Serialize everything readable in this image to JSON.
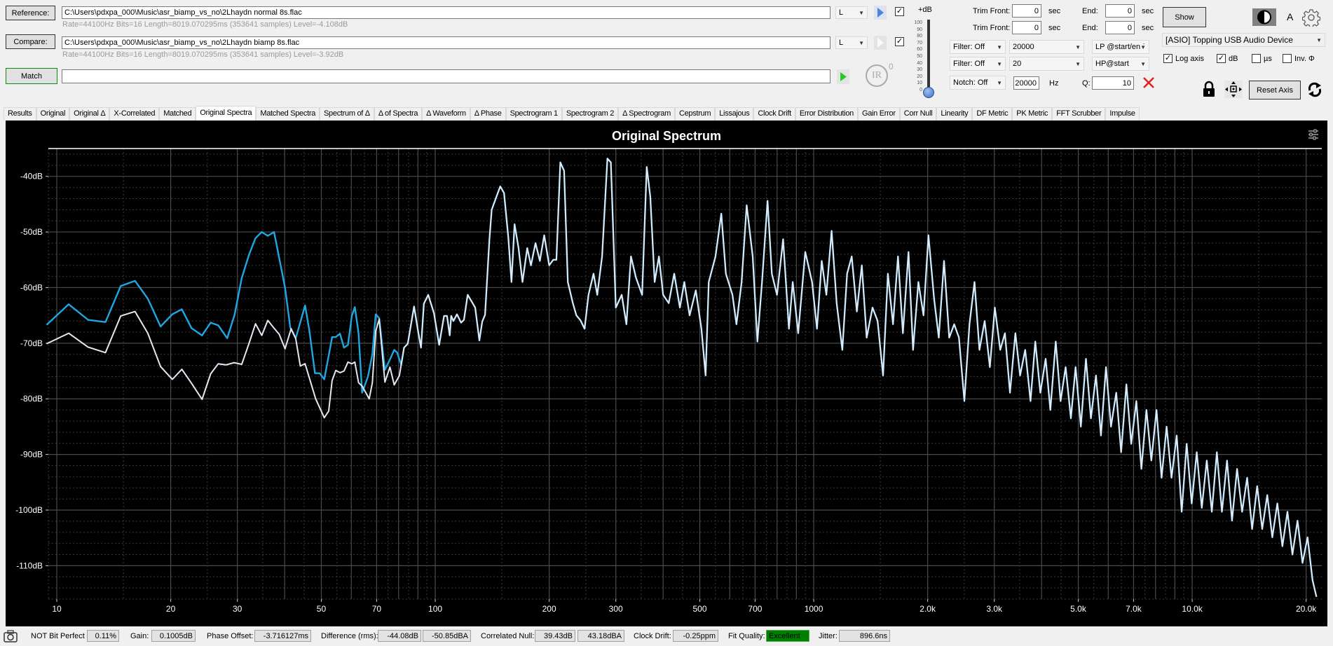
{
  "reference": {
    "button_label": "Reference:",
    "path": "C:\\Users\\pdxpa_000\\Music\\asr_biamp_vs_no\\2Lhaydn normal 8s.flac",
    "info": "Rate=44100Hz Bits=16 Length=8019.070295ms (353641 samples) Level=-4.108dB",
    "channel": "L",
    "checked": true
  },
  "compare": {
    "button_label": "Compare:",
    "path": "C:\\Users\\pdxpa_000\\Music\\asr_biamp_vs_no\\2Lhaydn biamp 8s.flac",
    "info": "Rate=44100Hz Bits=16 Length=8019.070295ms (353641 samples) Level=-3.92dB",
    "channel": "L",
    "checked": true
  },
  "match": {
    "button_label": "Match",
    "value": ""
  },
  "ir": {
    "label": "IR",
    "count": "0"
  },
  "gain_slider": {
    "label": "+dB",
    "ticks": [
      "100",
      "90",
      "80",
      "70",
      "60",
      "50",
      "40",
      "30",
      "20",
      "10",
      "0"
    ],
    "value": 0
  },
  "trim": [
    {
      "front_label": "Trim Front:",
      "front_value": "0",
      "front_unit": "sec",
      "end_label": "End:",
      "end_value": "0",
      "end_unit": "sec"
    },
    {
      "front_label": "Trim Front:",
      "front_value": "0",
      "front_unit": "sec",
      "end_label": "End:",
      "end_value": "0",
      "end_unit": "sec"
    }
  ],
  "filters": [
    {
      "mode": "Filter: Off",
      "freq": "20000",
      "type": "LP @start/end"
    },
    {
      "mode": "Filter: Off",
      "freq": "20",
      "type": "HP@start"
    }
  ],
  "notch": {
    "mode": "Notch: Off",
    "freq": "20000",
    "unit": "Hz",
    "q_label": "Q:",
    "q_value": "10"
  },
  "right_panel": {
    "show_label": "Show",
    "font_label": "A",
    "device": "[ASIO] Topping USB Audio Device",
    "options": [
      {
        "label": "Log axis",
        "checked": true
      },
      {
        "label": "dB",
        "checked": true
      },
      {
        "label": "µs",
        "checked": false
      },
      {
        "label": "Inv. Φ",
        "checked": false
      }
    ],
    "reset_axis_label": "Reset Axis"
  },
  "tabs": [
    "Results",
    "Original",
    "Original Δ",
    "X-Correlated",
    "Matched",
    "Original Spectra",
    "Matched Spectra",
    "Spectrum of Δ",
    "Δ of Spectra",
    "Δ Waveform",
    "Δ Phase",
    "Spectrogram 1",
    "Spectrogram 2",
    "Δ Spectrogram",
    "Cepstrum",
    "Lissajous",
    "Clock Drift",
    "Error Distribution",
    "Gain Error",
    "Corr Null",
    "Linearity",
    "DF Metric",
    "PK Metric",
    "FFT Scrubber",
    "Impulse"
  ],
  "active_tab": "Original Spectra",
  "chart_data": {
    "type": "line",
    "title": "Original Spectrum",
    "xscale": "log",
    "xlim": [
      9.5,
      22000
    ],
    "ylim": [
      -116,
      -35
    ],
    "grid": true,
    "background": "#000000",
    "xticks": [
      {
        "v": 10,
        "t": "10"
      },
      {
        "v": 20,
        "t": "20"
      },
      {
        "v": 30,
        "t": "30"
      },
      {
        "v": 50,
        "t": "50"
      },
      {
        "v": 70,
        "t": "70"
      },
      {
        "v": 100,
        "t": "100"
      },
      {
        "v": 200,
        "t": "200"
      },
      {
        "v": 300,
        "t": "300"
      },
      {
        "v": 500,
        "t": "500"
      },
      {
        "v": 700,
        "t": "700"
      },
      {
        "v": 1000,
        "t": "1000"
      },
      {
        "v": 2000,
        "t": "2.0k"
      },
      {
        "v": 3000,
        "t": "3.0k"
      },
      {
        "v": 5000,
        "t": "5.0k"
      },
      {
        "v": 7000,
        "t": "7.0k"
      },
      {
        "v": 10000,
        "t": "10.0k"
      },
      {
        "v": 20000,
        "t": "20.0k"
      }
    ],
    "yticks": [
      {
        "v": -40,
        "t": "-40dB"
      },
      {
        "v": -50,
        "t": "-50dB"
      },
      {
        "v": -60,
        "t": "-60dB"
      },
      {
        "v": -70,
        "t": "-70dB"
      },
      {
        "v": -80,
        "t": "-80dB"
      },
      {
        "v": -90,
        "t": "-90dB"
      },
      {
        "v": -100,
        "t": "-100dB"
      },
      {
        "v": -110,
        "t": "-110dB"
      }
    ],
    "series": [
      {
        "color": "#1ea7e1",
        "points": [
          [
            9.4,
            -66.7
          ],
          [
            10.75,
            -63.0
          ],
          [
            12.1,
            -65.8
          ],
          [
            13.45,
            -66.2
          ],
          [
            14.76,
            -59.7
          ],
          [
            16.1,
            -58.8
          ],
          [
            17.4,
            -62.0
          ],
          [
            18.8,
            -67.0
          ],
          [
            20.2,
            -64.8
          ],
          [
            21.4,
            -63.9
          ],
          [
            22.7,
            -67.3
          ],
          [
            24.2,
            -68.6
          ],
          [
            25.5,
            -66.3
          ],
          [
            26.7,
            -66.8
          ],
          [
            28.2,
            -69.1
          ],
          [
            29.5,
            -64.9
          ],
          [
            30.8,
            -58.3
          ],
          [
            32.2,
            -54.1
          ],
          [
            33.5,
            -51.1
          ],
          [
            34.8,
            -50.0
          ],
          [
            36.1,
            -50.7
          ],
          [
            37.5,
            -50.0
          ],
          [
            38.7,
            -54.7
          ],
          [
            40.1,
            -60.0
          ],
          [
            41.4,
            -67.2
          ],
          [
            42.8,
            -69.1
          ],
          [
            45.3,
            -63.2
          ],
          [
            46.5,
            -67.8
          ],
          [
            48.1,
            -75.4
          ],
          [
            49.5,
            -75.4
          ],
          [
            50.9,
            -76.5
          ],
          [
            53.4,
            -68.9
          ],
          [
            54.6,
            -68.9
          ],
          [
            56.0,
            -68.3
          ],
          [
            57.4,
            -70.8
          ],
          [
            58.8,
            -70.3
          ],
          [
            60.2,
            -65.1
          ],
          [
            61.3,
            -63.5
          ],
          [
            62.7,
            -68.2
          ],
          [
            64.1,
            -78.9
          ],
          [
            66.4,
            -76.0
          ],
          [
            68.2,
            -72.0
          ],
          [
            69.6,
            -64.8
          ],
          [
            71.1,
            -65.5
          ],
          [
            73.6,
            -74.8
          ],
          [
            75.9,
            -72.9
          ],
          [
            77.9,
            -71.2
          ],
          [
            79.3,
            -71.7
          ],
          [
            81.3,
            -73.9
          ]
        ]
      },
      {
        "color": "#e4e8f2",
        "points": [
          [
            9.4,
            -70.1
          ],
          [
            10.75,
            -68.2
          ],
          [
            12.1,
            -70.7
          ],
          [
            13.45,
            -71.7
          ],
          [
            14.76,
            -65.1
          ],
          [
            16.1,
            -64.3
          ],
          [
            17.4,
            -68.2
          ],
          [
            18.8,
            -74.2
          ],
          [
            20.2,
            -76.5
          ],
          [
            21.4,
            -74.7
          ],
          [
            22.8,
            -77.4
          ],
          [
            24.2,
            -80.1
          ],
          [
            25.5,
            -75.5
          ],
          [
            26.7,
            -73.7
          ],
          [
            28.0,
            -73.9
          ],
          [
            29.4,
            -73.5
          ],
          [
            30.8,
            -73.8
          ],
          [
            32.1,
            -70.3
          ],
          [
            33.5,
            -66.5
          ],
          [
            34.8,
            -68.6
          ],
          [
            36.1,
            -65.9
          ],
          [
            37.5,
            -67.3
          ],
          [
            38.7,
            -68.4
          ],
          [
            40.1,
            -71.0
          ],
          [
            41.6,
            -67.4
          ],
          [
            42.8,
            -69.2
          ],
          [
            44.0,
            -74.1
          ],
          [
            45.3,
            -73.7
          ],
          [
            48.3,
            -80.0
          ],
          [
            50.9,
            -83.4
          ],
          [
            52.3,
            -82.2
          ],
          [
            53.4,
            -76.7
          ],
          [
            54.6,
            -74.9
          ],
          [
            56.0,
            -75.3
          ],
          [
            57.4,
            -75.0
          ],
          [
            58.8,
            -73.4
          ],
          [
            60.2,
            -73.7
          ],
          [
            61.3,
            -73.4
          ],
          [
            62.7,
            -77.1
          ],
          [
            64.1,
            -77.7
          ],
          [
            66.9,
            -80.0
          ],
          [
            68.2,
            -77.1
          ],
          [
            69.6,
            -67.8
          ],
          [
            71.1,
            -65.7
          ],
          [
            73.6,
            -77.0
          ],
          [
            75.9,
            -74.3
          ],
          [
            77.9,
            -77.5
          ],
          [
            80.4,
            -75.8
          ]
        ]
      }
    ],
    "shared_points": [
      [
        82.7,
        -70.8
      ],
      [
        84.6,
        -70.1
      ],
      [
        87.9,
        -63.4
      ],
      [
        90.1,
        -67.9
      ],
      [
        91.7,
        -70.8
      ],
      [
        93.3,
        -62.9
      ],
      [
        95.8,
        -61.3
      ],
      [
        99.2,
        -64.6
      ],
      [
        102.4,
        -70.3
      ],
      [
        105.5,
        -65.1
      ],
      [
        107.4,
        -65.1
      ],
      [
        109.2,
        -68.6
      ],
      [
        110.2,
        -65.1
      ],
      [
        111.7,
        -66.0
      ],
      [
        114.1,
        -64.8
      ],
      [
        117.0,
        -66.3
      ],
      [
        119.1,
        -65.8
      ],
      [
        121.8,
        -61.3
      ],
      [
        125.3,
        -62.7
      ],
      [
        127.5,
        -63.6
      ],
      [
        130.8,
        -69.5
      ],
      [
        133.1,
        -66.1
      ],
      [
        135.4,
        -64.9
      ],
      [
        139,
        -51.4
      ],
      [
        141,
        -46
      ],
      [
        145,
        -43.7
      ],
      [
        148.5,
        -41.8
      ],
      [
        152,
        -43
      ],
      [
        156,
        -51
      ],
      [
        159,
        -59
      ],
      [
        162,
        -48.6
      ],
      [
        166,
        -52.9
      ],
      [
        170,
        -59
      ],
      [
        175,
        -52.9
      ],
      [
        179,
        -56
      ],
      [
        184,
        -52
      ],
      [
        189,
        -55.2
      ],
      [
        194,
        -50.6
      ],
      [
        200,
        -56
      ],
      [
        205,
        -55
      ],
      [
        209,
        -55
      ],
      [
        214,
        -37.5
      ],
      [
        219,
        -39
      ],
      [
        224,
        -59
      ],
      [
        231,
        -62.8
      ],
      [
        236,
        -65
      ],
      [
        242,
        -65.9
      ],
      [
        248,
        -67.4
      ],
      [
        254,
        -61.3
      ],
      [
        262,
        -57.5
      ],
      [
        268,
        -61.3
      ],
      [
        276,
        -54.4
      ],
      [
        285,
        -36.8
      ],
      [
        291,
        -37.5
      ],
      [
        300,
        -63.6
      ],
      [
        311,
        -61.3
      ],
      [
        320,
        -66.6
      ],
      [
        329,
        -54.4
      ],
      [
        339,
        -58.2
      ],
      [
        352,
        -61.3
      ],
      [
        362,
        -38.3
      ],
      [
        370,
        -43.7
      ],
      [
        380,
        -59
      ],
      [
        390,
        -54.4
      ],
      [
        400,
        -61.3
      ],
      [
        414,
        -62.8
      ],
      [
        428,
        -57.5
      ],
      [
        443,
        -63.6
      ],
      [
        455,
        -59
      ],
      [
        470,
        -65
      ],
      [
        488,
        -60.5
      ],
      [
        505,
        -67.4
      ],
      [
        518,
        -75.8
      ],
      [
        528,
        -59
      ],
      [
        550,
        -54.4
      ],
      [
        570,
        -46.7
      ],
      [
        586,
        -57.5
      ],
      [
        610,
        -61.3
      ],
      [
        625,
        -66.6
      ],
      [
        645,
        -59
      ],
      [
        665,
        -45.2
      ],
      [
        690,
        -54.4
      ],
      [
        710,
        -69.7
      ],
      [
        730,
        -59
      ],
      [
        755,
        -44.4
      ],
      [
        775,
        -57.5
      ],
      [
        800,
        -61.3
      ],
      [
        830,
        -51.3
      ],
      [
        860,
        -67.4
      ],
      [
        880,
        -59
      ],
      [
        910,
        -68.2
      ],
      [
        950,
        -53.6
      ],
      [
        990,
        -59
      ],
      [
        1020,
        -67.4
      ],
      [
        1050,
        -55.2
      ],
      [
        1080,
        -61.3
      ],
      [
        1115,
        -49.8
      ],
      [
        1150,
        -62.8
      ],
      [
        1190,
        -71.2
      ],
      [
        1225,
        -57.5
      ],
      [
        1260,
        -54.4
      ],
      [
        1300,
        -64.3
      ],
      [
        1340,
        -56
      ],
      [
        1380,
        -69
      ],
      [
        1430,
        -63.6
      ],
      [
        1475,
        -66
      ],
      [
        1525,
        -75.8
      ],
      [
        1570,
        -57.5
      ],
      [
        1620,
        -66.6
      ],
      [
        1670,
        -54.4
      ],
      [
        1720,
        -68.2
      ],
      [
        1780,
        -53.6
      ],
      [
        1830,
        -71.2
      ],
      [
        1890,
        -59
      ],
      [
        1950,
        -65
      ],
      [
        2010,
        -50.6
      ],
      [
        2080,
        -62
      ],
      [
        2140,
        -69
      ],
      [
        2210,
        -55.2
      ],
      [
        2280,
        -69
      ],
      [
        2350,
        -66.6
      ],
      [
        2420,
        -69
      ],
      [
        2500,
        -80.4
      ],
      [
        2580,
        -66.6
      ],
      [
        2660,
        -59
      ],
      [
        2740,
        -71.2
      ],
      [
        2830,
        -66
      ],
      [
        2920,
        -74.3
      ],
      [
        3010,
        -63.6
      ],
      [
        3110,
        -71.2
      ],
      [
        3200,
        -68.2
      ],
      [
        3300,
        -78.9
      ],
      [
        3410,
        -68.2
      ],
      [
        3510,
        -75.8
      ],
      [
        3620,
        -71.2
      ],
      [
        3740,
        -80.4
      ],
      [
        3850,
        -69.7
      ],
      [
        3970,
        -78.9
      ],
      [
        4100,
        -72.8
      ],
      [
        4220,
        -82
      ],
      [
        4360,
        -69.7
      ],
      [
        4490,
        -80.4
      ],
      [
        4630,
        -74.3
      ],
      [
        4780,
        -83.5
      ],
      [
        4920,
        -74.3
      ],
      [
        5080,
        -85
      ],
      [
        5240,
        -72.8
      ],
      [
        5400,
        -83.5
      ],
      [
        5570,
        -75.8
      ],
      [
        5740,
        -86.6
      ],
      [
        5920,
        -74.3
      ],
      [
        6100,
        -85
      ],
      [
        6300,
        -78.9
      ],
      [
        6490,
        -89.6
      ],
      [
        6700,
        -77.4
      ],
      [
        6900,
        -88.1
      ],
      [
        7120,
        -80.4
      ],
      [
        7340,
        -92.6
      ],
      [
        7570,
        -82
      ],
      [
        7800,
        -91.1
      ],
      [
        8050,
        -82
      ],
      [
        8300,
        -94.2
      ],
      [
        8560,
        -85
      ],
      [
        8820,
        -94.2
      ],
      [
        9100,
        -86.6
      ],
      [
        9380,
        -100.3
      ],
      [
        9670,
        -88.1
      ],
      [
        9970,
        -98.8
      ],
      [
        10280,
        -89.6
      ],
      [
        10600,
        -99.6
      ],
      [
        10930,
        -91.1
      ],
      [
        11270,
        -100.3
      ],
      [
        11620,
        -89.6
      ],
      [
        11980,
        -100.3
      ],
      [
        12360,
        -91.1
      ],
      [
        12740,
        -101.9
      ],
      [
        13140,
        -92.6
      ],
      [
        13550,
        -100.3
      ],
      [
        13970,
        -94.2
      ],
      [
        14400,
        -103.4
      ],
      [
        14850,
        -95.7
      ],
      [
        15310,
        -103.4
      ],
      [
        15790,
        -97.3
      ],
      [
        16280,
        -104.9
      ],
      [
        16790,
        -98.8
      ],
      [
        17310,
        -106.5
      ],
      [
        17850,
        -100.3
      ],
      [
        18400,
        -108
      ],
      [
        18980,
        -101.9
      ],
      [
        19570,
        -109.5
      ],
      [
        20180,
        -104.9
      ],
      [
        20800,
        -112.6
      ],
      [
        21300,
        -115.6
      ]
    ]
  },
  "status": {
    "bit_perfect_label": "NOT Bit Perfect",
    "bit_perfect_value": "0.11%",
    "gain_label": "Gain:",
    "gain_value": "0.1005dB",
    "phase_label": "Phase Offset:",
    "phase_value": "-3.716127ms",
    "diff_label": "Difference (rms):",
    "diff_db": "-44.08dB",
    "diff_dba": "-50.85dBA",
    "null_label": "Correlated Null:",
    "null_db": "39.43dB",
    "null_dba": "43.18dBA",
    "drift_label": "Clock Drift:",
    "drift_value": "-0.25ppm",
    "fit_label": "Fit Quality:",
    "fit_value": "Excellent",
    "fit_color": "#008000",
    "jitter_label": "Jitter:",
    "jitter_value": "896.6ns"
  }
}
